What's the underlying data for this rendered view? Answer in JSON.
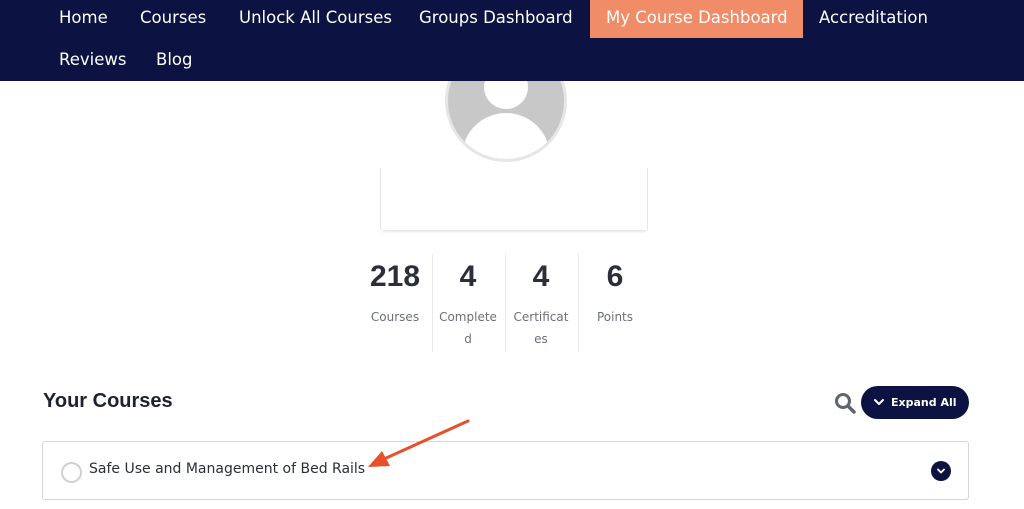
{
  "nav": {
    "items": [
      {
        "label": "Home"
      },
      {
        "label": "Courses"
      },
      {
        "label": "Unlock All Courses"
      },
      {
        "label": "Groups Dashboard"
      },
      {
        "label": "My Course Dashboard",
        "active": true
      },
      {
        "label": "Accreditation"
      },
      {
        "label": "Reviews"
      },
      {
        "label": "Blog"
      }
    ]
  },
  "profile": {
    "avatar_icon": "user-placeholder-icon"
  },
  "stats": [
    {
      "value": "218",
      "label": "Courses"
    },
    {
      "value": "4",
      "label": "Completed"
    },
    {
      "value": "4",
      "label": "Certificates"
    },
    {
      "value": "6",
      "label": "Points"
    }
  ],
  "courses_section": {
    "title": "Your Courses",
    "expand_label": "Expand All",
    "search_icon": "search-icon",
    "items": [
      {
        "title": "Safe Use and Management of Bed Rails"
      }
    ]
  },
  "colors": {
    "nav_bg": "#0c1241",
    "active_tab": "#f08c67",
    "annotation_arrow": "#e8502a"
  }
}
